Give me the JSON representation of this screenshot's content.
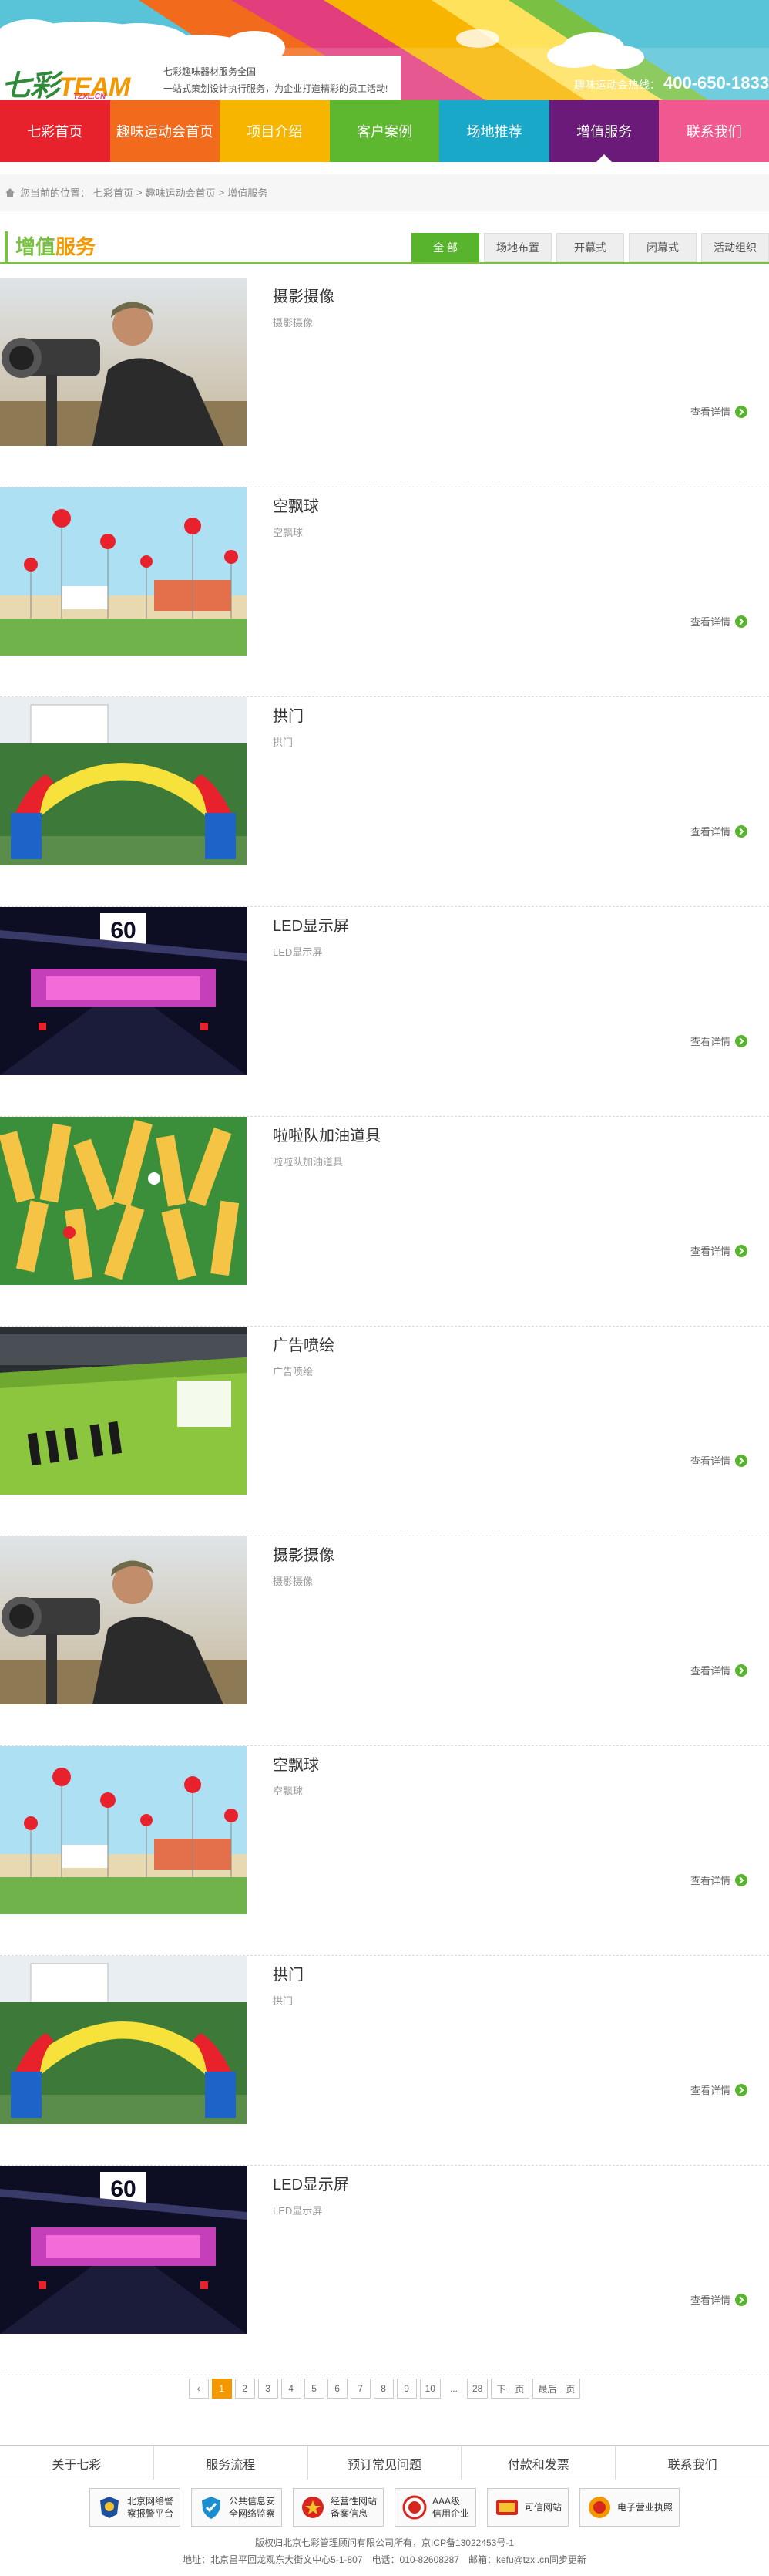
{
  "header": {
    "logo_main": "七彩",
    "logo_team": "TEAM",
    "logo_sub": "TZXL.CN",
    "slogan_line1": "七彩趣味器材服务全国",
    "slogan_line2": "一站式策划设计执行服务，为企业打造精彩的员工活动!",
    "hotline_label": "趣味运动会热线：",
    "hotline_number": "400-650-1833"
  },
  "nav": [
    {
      "label": "七彩首页",
      "color": "#e8222c"
    },
    {
      "label": "趣味运动会首页",
      "color": "#f26b1d"
    },
    {
      "label": "项目介绍",
      "color": "#f8b500"
    },
    {
      "label": "客户案例",
      "color": "#5db82f"
    },
    {
      "label": "场地推荐",
      "color": "#1aa8c9"
    },
    {
      "label": "增值服务",
      "color": "#6b1a7a"
    },
    {
      "label": "联系我们",
      "color": "#f1588f"
    }
  ],
  "breadcrumb": {
    "prefix": "您当前的位置：",
    "items": [
      "七彩首页",
      "趣味运动会首页",
      "增值服务"
    ],
    "sep": ">"
  },
  "section": {
    "title_a": "增值",
    "title_b": "服务",
    "tabs": [
      "全 部",
      "场地布置",
      "开幕式",
      "闭幕式",
      "活动组织"
    ]
  },
  "items": [
    {
      "title": "摄影摄像",
      "desc": "摄影摄像",
      "more": "查看详情",
      "image": "photographer"
    },
    {
      "title": "空飘球",
      "desc": "空飘球",
      "more": "查看详情",
      "image": "balloons"
    },
    {
      "title": "拱门",
      "desc": "拱门",
      "more": "查看详情",
      "image": "arch"
    },
    {
      "title": "LED显示屏",
      "desc": "LED显示屏",
      "more": "查看详情",
      "image": "led"
    },
    {
      "title": "啦啦队加油道具",
      "desc": "啦啦队加油道具",
      "more": "查看详情",
      "image": "cheer"
    },
    {
      "title": "广告喷绘",
      "desc": "广告喷绘",
      "more": "查看详情",
      "image": "print"
    },
    {
      "title": "摄影摄像",
      "desc": "摄影摄像",
      "more": "查看详情",
      "image": "photographer"
    },
    {
      "title": "空飘球",
      "desc": "空飘球",
      "more": "查看详情",
      "image": "balloons"
    },
    {
      "title": "拱门",
      "desc": "拱门",
      "more": "查看详情",
      "image": "arch"
    },
    {
      "title": "LED显示屏",
      "desc": "LED显示屏",
      "more": "查看详情",
      "image": "led"
    }
  ],
  "pager": {
    "prev": "‹",
    "pages": [
      "1",
      "2",
      "3",
      "4",
      "5",
      "6",
      "7",
      "8",
      "9",
      "10"
    ],
    "current": "1",
    "dots": "...",
    "last_page": "28",
    "next": "下一页",
    "last": "最后一页"
  },
  "footer": {
    "links": [
      "关于七彩",
      "服务流程",
      "预订常见问题",
      "付款和发票",
      "联系我们"
    ],
    "badges": [
      {
        "l1": "北京网络警",
        "l2": "察报警平台",
        "icon": "police-icon"
      },
      {
        "l1": "公共信息安",
        "l2": "全网络监察",
        "icon": "shield-icon"
      },
      {
        "l1": "经营性网站",
        "l2": "备案信息",
        "icon": "seal-icon"
      },
      {
        "l1": "AAA级",
        "l2": "信用企业",
        "icon": "credit-icon"
      },
      {
        "l1": "可信网站",
        "l2": "",
        "icon": "trust-icon"
      },
      {
        "l1": "电子营业执照",
        "l2": "",
        "icon": "license-icon"
      }
    ],
    "copyright": "版权归北京七彩管理顾问有限公司所有，京ICP备13022453号-1",
    "address": "地址：北京昌平回龙观东大街文中心5-1-807　电话：010-82608287　邮箱：kefu@tzxl.cn同步更新"
  }
}
